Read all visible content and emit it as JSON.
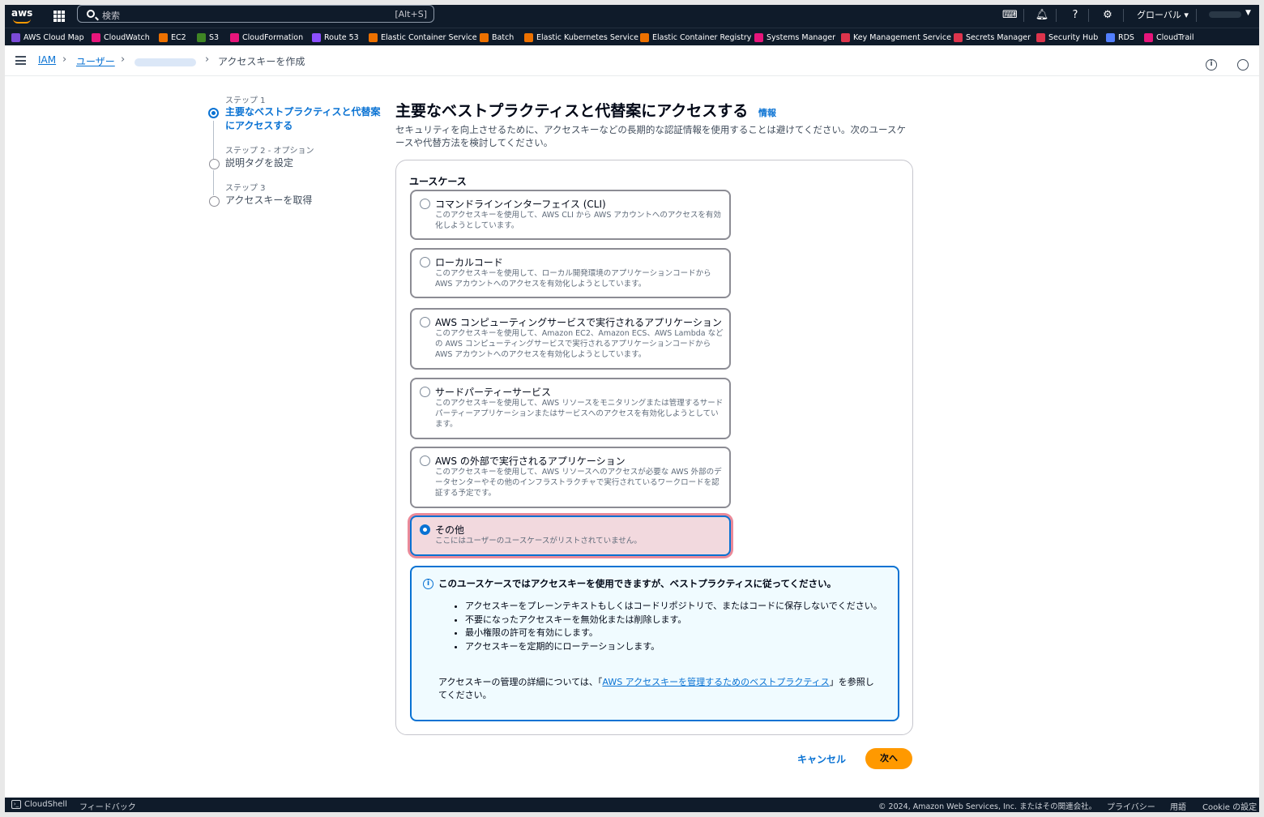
{
  "topbar": {
    "logo": "aws",
    "search_placeholder": "検索",
    "search_shortcut": "[Alt+S]",
    "region": "グローバル ▾",
    "icons": [
      "cloudshell-icon",
      "bell-icon",
      "help-icon",
      "gear-icon"
    ]
  },
  "favorites": [
    {
      "label": "AWS Cloud Map",
      "color": "#7b4bd8"
    },
    {
      "label": "CloudWatch",
      "color": "#e7157b"
    },
    {
      "label": "EC2",
      "color": "#ed7100"
    },
    {
      "label": "S3",
      "color": "#3f8624"
    },
    {
      "label": "CloudFormation",
      "color": "#e7157b"
    },
    {
      "label": "Route 53",
      "color": "#8c4fff"
    },
    {
      "label": "Elastic Container Service",
      "color": "#ed7100"
    },
    {
      "label": "Batch",
      "color": "#ed7100"
    },
    {
      "label": "Elastic Kubernetes Service",
      "color": "#ed7100"
    },
    {
      "label": "Elastic Container Registry",
      "color": "#ed7100"
    },
    {
      "label": "Systems Manager",
      "color": "#e7157b"
    },
    {
      "label": "Key Management Service",
      "color": "#dd344c"
    },
    {
      "label": "Secrets Manager",
      "color": "#dd344c"
    },
    {
      "label": "Security Hub",
      "color": "#dd344c"
    },
    {
      "label": "RDS",
      "color": "#527fff"
    },
    {
      "label": "CloudTrail",
      "color": "#e7157b"
    }
  ],
  "breadcrumb": {
    "iam": "IAM",
    "users": "ユーザー",
    "current": "アクセスキーを作成"
  },
  "steps": [
    {
      "label": "ステップ 1",
      "title1": "主要なベストプラクティスと代替案",
      "title2": "にアクセスする"
    },
    {
      "label": "ステップ 2 - オプション",
      "title1": "説明タグを設定"
    },
    {
      "label": "ステップ 3",
      "title1": "アクセスキーを取得"
    }
  ],
  "main": {
    "heading": "主要なベストプラクティスと代替案にアクセスする",
    "info": "情報",
    "description": "セキュリティを向上させるために、アクセスキーなどの長期的な認証情報を使用することは避けてください。次のユースケースや代替方法を検討してください。",
    "usecase_title": "ユースケース"
  },
  "options": [
    {
      "title": "コマンドラインインターフェイス (CLI)",
      "desc": "このアクセスキーを使用して、AWS CLI から AWS アカウントへのアクセスを有効化しようとしています。"
    },
    {
      "title": "ローカルコード",
      "desc": "このアクセスキーを使用して、ローカル開発環境のアプリケーションコードから AWS アカウントへのアクセスを有効化しようとしています。"
    },
    {
      "title": "AWS コンピューティングサービスで実行されるアプリケーション",
      "desc": "このアクセスキーを使用して、Amazon EC2、Amazon ECS、AWS Lambda などの AWS コンピューティングサービスで実行されるアプリケーションコードから AWS アカウントへのアクセスを有効化しようとしています。"
    },
    {
      "title": "サードパーティーサービス",
      "desc": "このアクセスキーを使用して、AWS リソースをモニタリングまたは管理するサードパーティーアプリケーションまたはサービスへのアクセスを有効化しようとしています。"
    },
    {
      "title": "AWS の外部で実行されるアプリケーション",
      "desc": "このアクセスキーを使用して、AWS リソースへのアクセスが必要な AWS 外部のデータセンターやその他のインフラストラクチャで実行されているワークロードを認証する予定です。"
    },
    {
      "title": "その他",
      "desc": "ここにはユーザーのユースケースがリストされていません。"
    }
  ],
  "alert": {
    "heading": "このユースケースではアクセスキーを使用できますが、ベストプラクティスに従ってください。",
    "items": [
      "アクセスキーをプレーンテキストもしくはコードリポジトリで、またはコードに保存しないでください。",
      "不要になったアクセスキーを無効化または削除します。",
      "最小権限の許可を有効にします。",
      "アクセスキーを定期的にローテーションします。"
    ],
    "foot_pre": "アクセスキーの管理の詳細については、「",
    "foot_link": "AWS アクセスキーを管理するためのベストプラクティス",
    "foot_post": "」を参照してください。"
  },
  "actions": {
    "cancel": "キャンセル",
    "next": "次へ"
  },
  "footer": {
    "cloudshell": "CloudShell",
    "feedback": "フィードバック",
    "copyright": "© 2024, Amazon Web Services, Inc. またはその関連会社。",
    "privacy": "プライバシー",
    "terms": "用語",
    "cookie": "Cookie の設定"
  }
}
